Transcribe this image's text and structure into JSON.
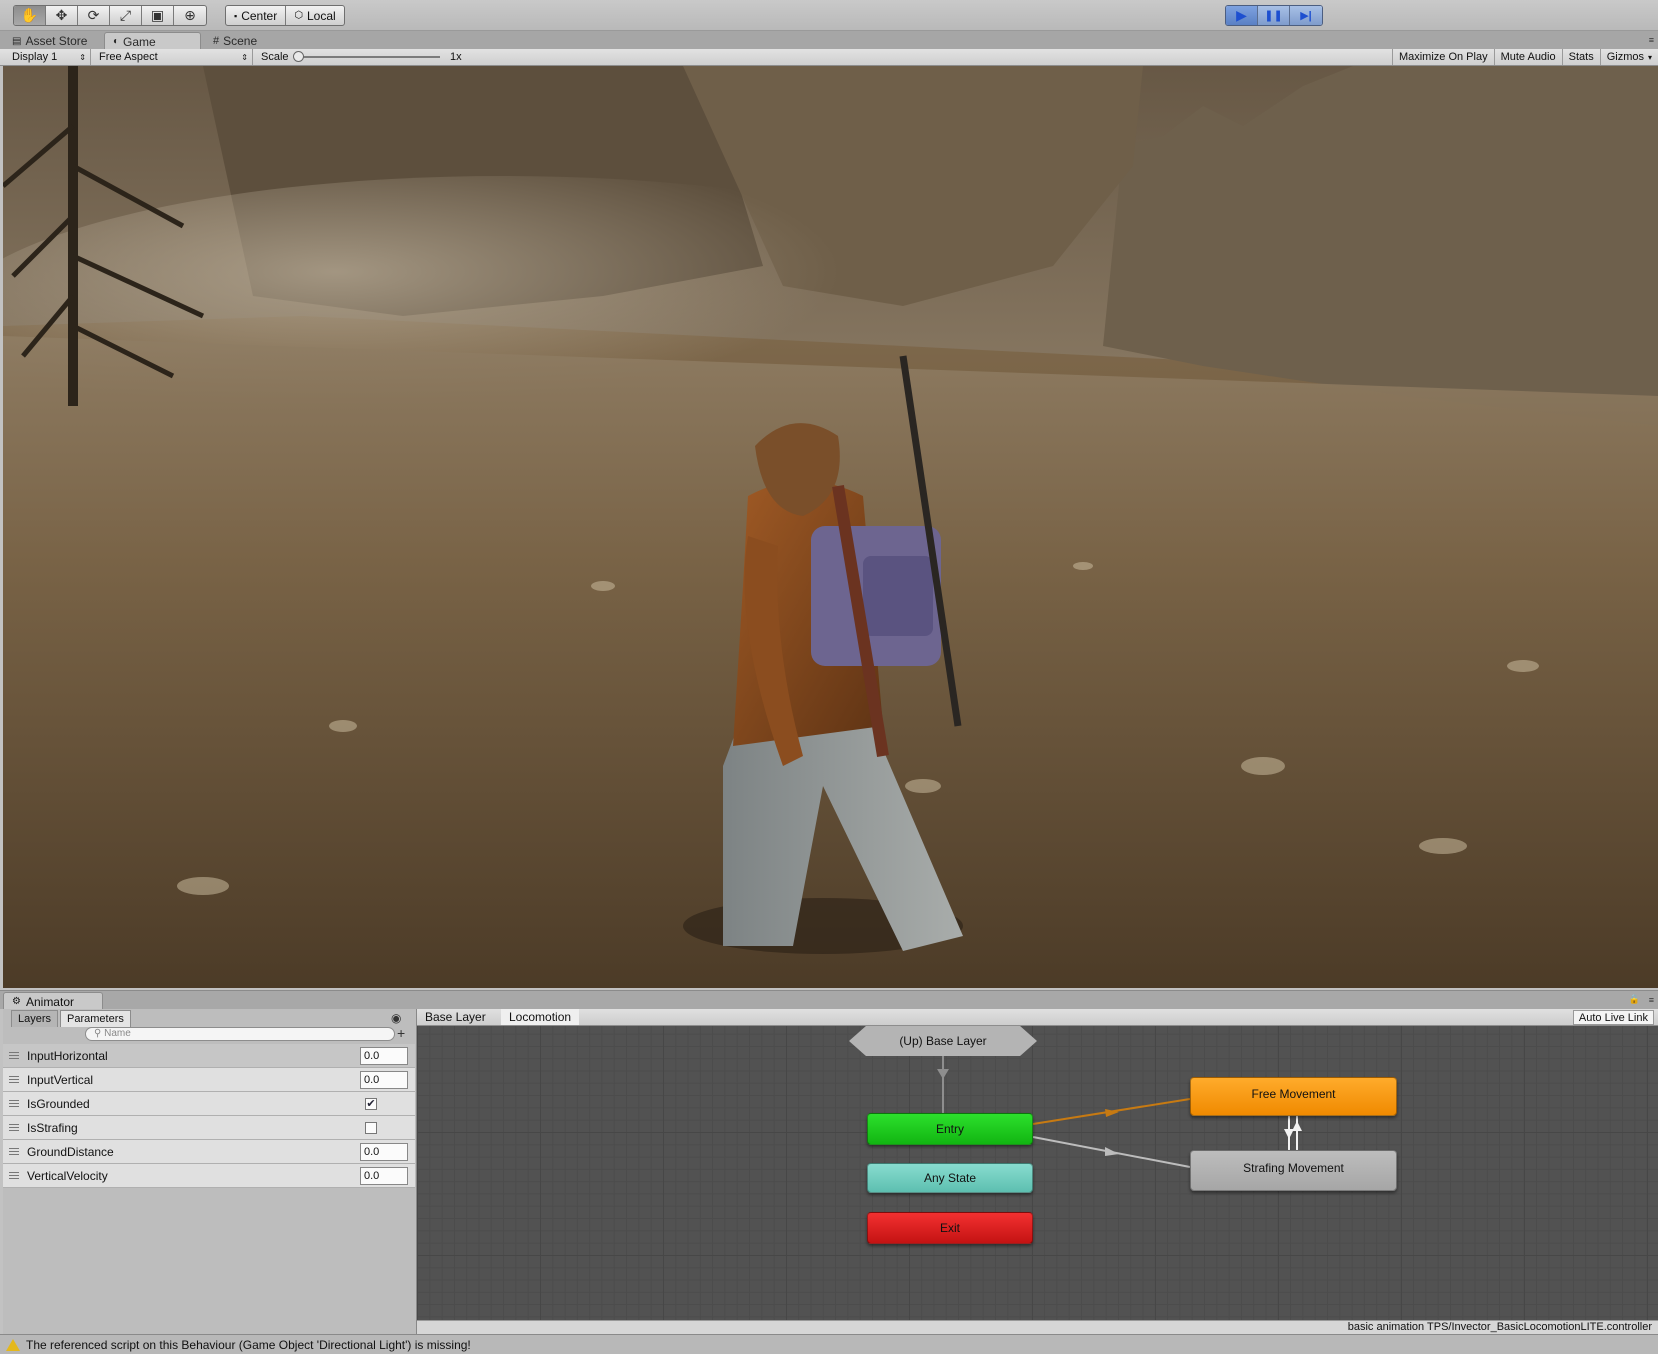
{
  "toolbar": {
    "tools": [
      {
        "name": "hand-tool",
        "glyph": "✋"
      },
      {
        "name": "move-tool",
        "glyph": "✥"
      },
      {
        "name": "rotate-tool",
        "glyph": "⟳"
      },
      {
        "name": "scale-tool",
        "glyph": "⤢"
      },
      {
        "name": "rect-tool",
        "glyph": "▣"
      },
      {
        "name": "transform-tool",
        "glyph": "⊕"
      }
    ],
    "pivot_label": "Center",
    "space_label": "Local",
    "play_glyph": "▶",
    "pause_glyph": "❚❚",
    "step_glyph": "▶|"
  },
  "tabs": {
    "asset_store": "Asset Store",
    "game": "Game",
    "scene": "Scene"
  },
  "gamebar": {
    "display": "Display 1",
    "aspect": "Free Aspect",
    "scale_label": "Scale",
    "scale_value": "1x",
    "maximize": "Maximize On Play",
    "mute": "Mute Audio",
    "stats": "Stats",
    "gizmos": "Gizmos"
  },
  "animator": {
    "tab_title": "Animator",
    "panel_tabs": {
      "layers": "Layers",
      "parameters": "Parameters"
    },
    "search_placeholder": "Name",
    "parameters": [
      {
        "name": "InputHorizontal",
        "type": "float",
        "value": "0.0"
      },
      {
        "name": "InputVertical",
        "type": "float",
        "value": "0.0"
      },
      {
        "name": "IsGrounded",
        "type": "bool",
        "value": true
      },
      {
        "name": "IsStrafing",
        "type": "bool",
        "value": false
      },
      {
        "name": "GroundDistance",
        "type": "float",
        "value": "0.0"
      },
      {
        "name": "VerticalVelocity",
        "type": "float",
        "value": "0.0"
      }
    ],
    "breadcrumb": [
      "Base Layer",
      "Locomotion"
    ],
    "auto_live_link": "Auto Live Link",
    "nodes": {
      "up": "(Up) Base Layer",
      "entry": "Entry",
      "any_state": "Any State",
      "exit": "Exit",
      "free_movement": "Free Movement",
      "strafing_movement": "Strafing Movement"
    },
    "controller_path": "basic animation TPS/Invector_BasicLocomotionLITE.controller"
  },
  "console": {
    "message": "The referenced script on this Behaviour (Game Object 'Directional Light') is missing!"
  },
  "colors": {
    "entry": "#1fcc1f",
    "any_state": "#6fcfc0",
    "exit": "#e01f1f",
    "default_state": "#f7960f",
    "state": "#b0b0b0",
    "transition_default": "#c77a12",
    "transition": "#bdbdbd"
  }
}
